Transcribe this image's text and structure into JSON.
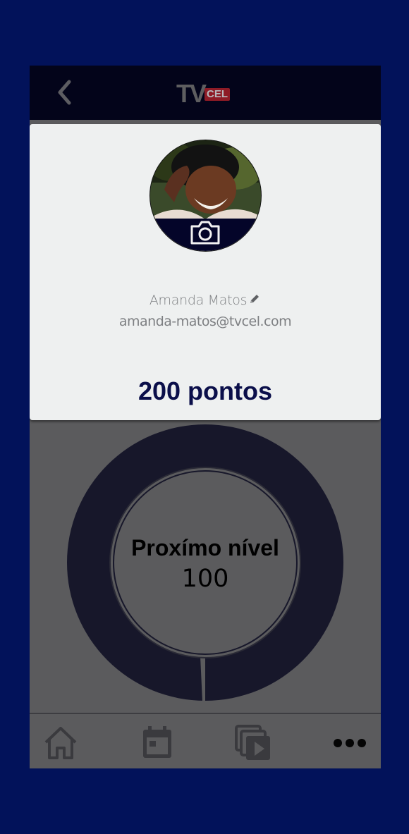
{
  "header": {
    "logo_tv": "TV",
    "logo_cel": "CEL"
  },
  "profile": {
    "name": "Amanda Matos",
    "email": "amanda-matos@tvcel.com",
    "points": "200 pontos"
  },
  "progress": {
    "label": "Proxímo nível",
    "value": "100",
    "fraction": 0.99
  },
  "nav": {
    "items": [
      "home-icon",
      "calendar-icon",
      "video-library-icon",
      "more-icon"
    ]
  },
  "colors": {
    "background": "#02125a",
    "app_bar": "#03041a",
    "card": "#eef0f0",
    "points_text": "#0b0f4a",
    "ring": "#17172a"
  }
}
